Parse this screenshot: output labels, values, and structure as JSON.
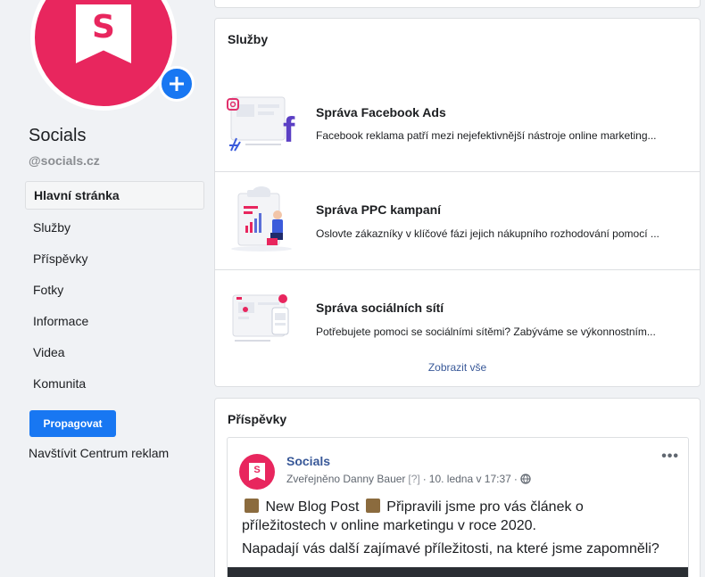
{
  "page": {
    "name": "Socials",
    "handle": "@socials.cz",
    "avatar_letter": "S"
  },
  "nav": {
    "items": [
      {
        "label": "Hlavní stránka",
        "active": true
      },
      {
        "label": "Služby"
      },
      {
        "label": "Příspěvky"
      },
      {
        "label": "Fotky"
      },
      {
        "label": "Informace"
      },
      {
        "label": "Videa"
      },
      {
        "label": "Komunita"
      }
    ],
    "promote_label": "Propagovat",
    "ads_center_label": "Navštívit Centrum reklam"
  },
  "services": {
    "title": "Služby",
    "items": [
      {
        "title": "Správa Facebook Ads",
        "desc": "Facebook reklama patří mezi nejefektivnější nástroje online marketing...",
        "icon": "facebook-ads-illustration"
      },
      {
        "title": "Správa PPC kampaní",
        "desc": "Oslovte zákazníky v klíčové fázi jejich nákupního rozhodování pomocí ...",
        "icon": "ppc-illustration"
      },
      {
        "title": "Správa sociálních sítí",
        "desc": "Potřebujete pomoci se sociálními sítěmi? Zabýváme se výkonnostním...",
        "icon": "social-media-illustration"
      }
    ],
    "show_all_label": "Zobrazit vše"
  },
  "posts": {
    "title": "Příspěvky",
    "post": {
      "author": "Socials",
      "published_by": "Zveřejněno Danny Bauer",
      "help_marker": "[?]",
      "separator": "·",
      "date": "10. ledna v 17:37",
      "more_label": "•••",
      "text_line1_pre": "New Blog Post",
      "text_line1_post": "Připravili jsme pro vás článek o příležitostech v online marketingu v roce 2020.",
      "text_line2": "Napadají vás další zajímavé příležitosti, na které jsme zapomněli?"
    }
  },
  "colors": {
    "brand": "#e8265e",
    "primary_button": "#1877f2",
    "link": "#385898"
  }
}
